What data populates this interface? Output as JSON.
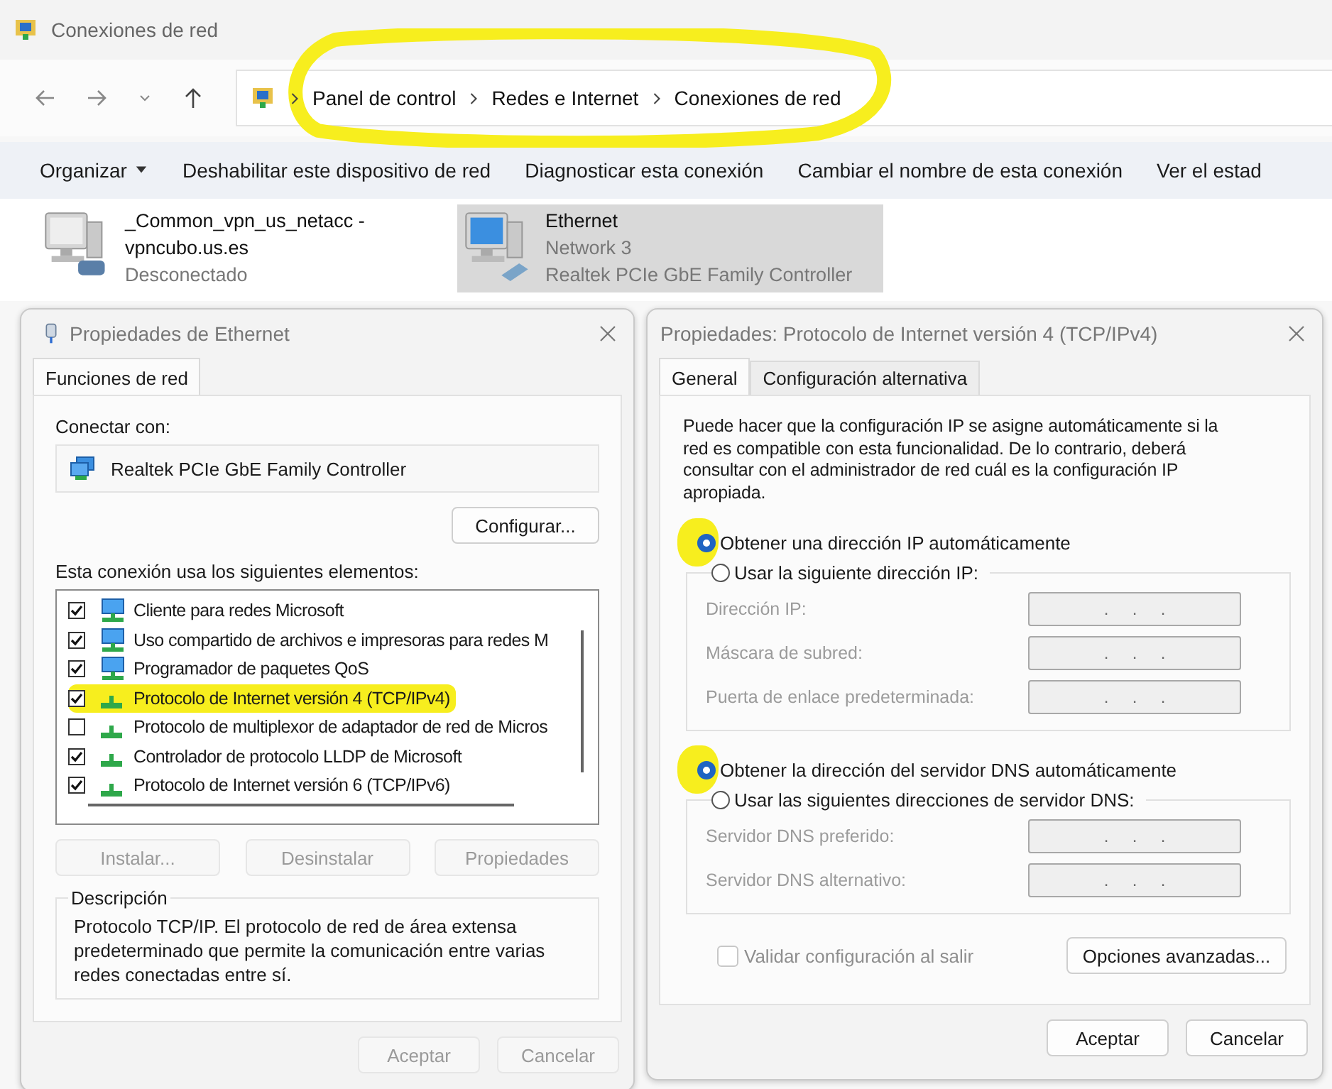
{
  "window": {
    "title": "Conexiones de red"
  },
  "address_bar": {
    "highlighted": true,
    "crumbs": [
      "Panel de control",
      "Redes e Internet",
      "Conexiones de red"
    ]
  },
  "toolbar": [
    {
      "label": "Organizar",
      "kind": "menu"
    },
    {
      "label": "Deshabilitar este dispositivo de red",
      "kind": "command"
    },
    {
      "label": "Diagnosticar esta conexión",
      "kind": "command"
    },
    {
      "label": "Cambiar el nombre de esta conexión",
      "kind": "command"
    },
    {
      "label": "Ver el estad",
      "kind": "command"
    }
  ],
  "connections": [
    {
      "name": "_Common_vpn_us_netacc - vpncubo.us.es",
      "details": [
        "Desconectado"
      ],
      "kind": "vpn",
      "selected": false
    },
    {
      "name": "Ethernet",
      "details": [
        "Network 3",
        "Realtek PCIe GbE Family Controller"
      ],
      "kind": "ethernet",
      "selected": true
    }
  ],
  "ethernet_dialog": {
    "title": "Propiedades de Ethernet",
    "tabs": [
      {
        "label": "Funciones de red",
        "selected": true
      }
    ],
    "connect_label": "Conectar con:",
    "adapter": "Realtek PCIe GbE Family Controller",
    "configure_button": "Configurar...",
    "components_label": "Esta conexión usa los siguientes elementos:",
    "components": [
      {
        "label": "Cliente para redes Microsoft",
        "kind": "client",
        "checked": true,
        "highlighted": false
      },
      {
        "label": "Uso compartido de archivos e impresoras para redes M",
        "kind": "client",
        "checked": true,
        "highlighted": false
      },
      {
        "label": "Programador de paquetes QoS",
        "kind": "client",
        "checked": true,
        "highlighted": false
      },
      {
        "label": "Protocolo de Internet versión 4 (TCP/IPv4)",
        "kind": "protocol",
        "checked": true,
        "highlighted": true
      },
      {
        "label": "Protocolo de multiplexor de adaptador de red de Micros",
        "kind": "protocol",
        "checked": false,
        "highlighted": false
      },
      {
        "label": "Controlador de protocolo LLDP de Microsoft",
        "kind": "protocol",
        "checked": true,
        "highlighted": false
      },
      {
        "label": "Protocolo de Internet versión 6 (TCP/IPv6)",
        "kind": "protocol",
        "checked": true,
        "highlighted": false
      }
    ],
    "item_buttons": [
      {
        "label": "Instalar...",
        "disabled": true
      },
      {
        "label": "Desinstalar",
        "disabled": true
      },
      {
        "label": "Propiedades",
        "disabled": true
      }
    ],
    "description_title": "Descripción",
    "description": "Protocolo TCP/IP. El protocolo de red de área extensa predeterminado que permite la comunicación entre varias redes conectadas entre sí.",
    "footer_buttons": [
      {
        "label": "Aceptar",
        "disabled": true
      },
      {
        "label": "Cancelar",
        "disabled": true
      }
    ]
  },
  "ipv4_dialog": {
    "title": "Propiedades: Protocolo de Internet versión 4 (TCP/IPv4)",
    "tabs": [
      {
        "label": "General",
        "selected": true
      },
      {
        "label": "Configuración alternativa",
        "selected": false
      }
    ],
    "intro": "Puede hacer que la configuración IP se asigne automáticamente si la red es compatible con esta funcionalidad. De lo contrario, deberá consultar con el administrador de red cuál es la configuración IP apropiada.",
    "ip_auto": {
      "label": "Obtener una dirección IP automáticamente",
      "selected": true,
      "highlighted": true
    },
    "ip_manual": {
      "label": "Usar la siguiente dirección IP:",
      "selected": false,
      "disabled": true,
      "fields": [
        {
          "label": "Dirección IP:",
          "value": ".     .     ."
        },
        {
          "label": "Máscara de subred:",
          "value": ".     .     ."
        },
        {
          "label": "Puerta de enlace predeterminada:",
          "value": ".     .     ."
        }
      ]
    },
    "dns_auto": {
      "label": "Obtener la dirección del servidor DNS automáticamente",
      "selected": true,
      "highlighted": true
    },
    "dns_manual": {
      "label": "Usar las siguientes direcciones de servidor DNS:",
      "selected": false,
      "disabled": true,
      "fields": [
        {
          "label": "Servidor DNS preferido:",
          "value": ".     .     ."
        },
        {
          "label": "Servidor DNS alternativo:",
          "value": ".     .     ."
        }
      ]
    },
    "validate": {
      "label": "Validar configuración al salir",
      "checked": false,
      "disabled": true
    },
    "advanced_button": "Opciones avanzadas...",
    "footer_buttons": [
      {
        "label": "Aceptar",
        "disabled": false
      },
      {
        "label": "Cancelar",
        "disabled": false
      }
    ]
  }
}
